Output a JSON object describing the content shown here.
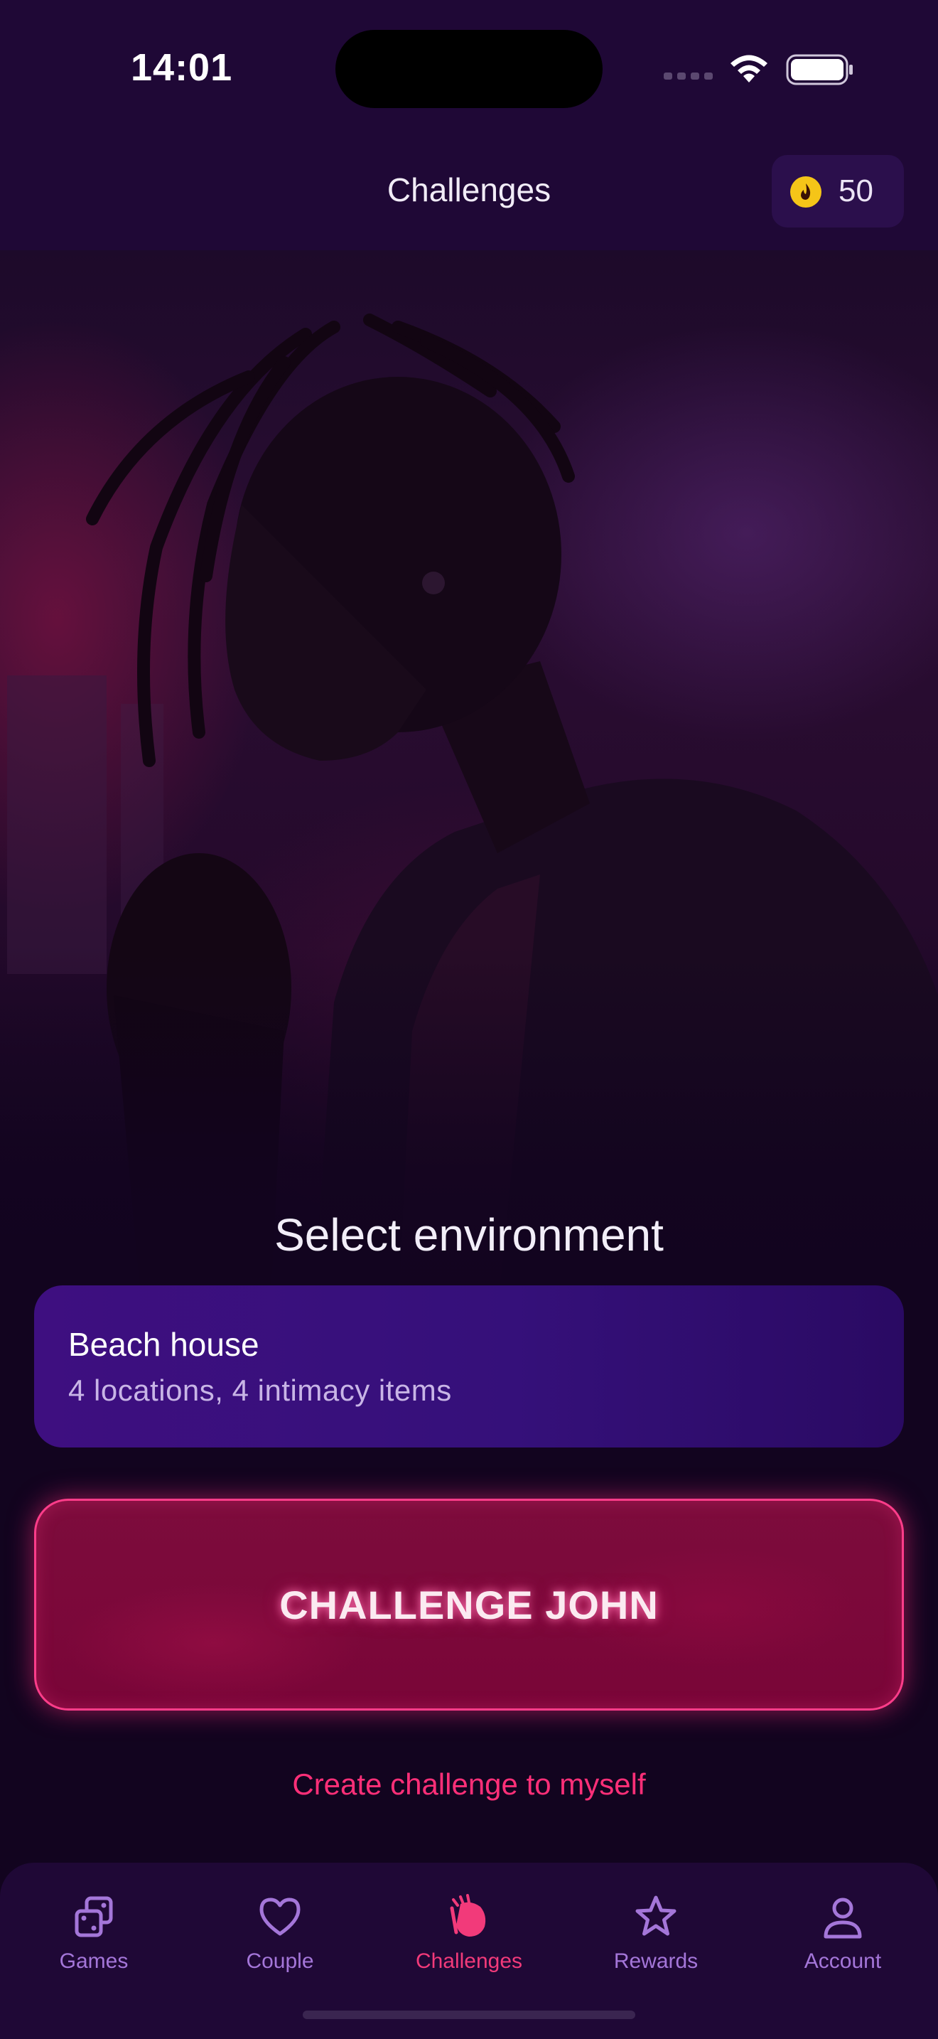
{
  "status_bar": {
    "time": "14:01"
  },
  "header": {
    "title": "Challenges",
    "coin_icon": "flame-coin-icon",
    "coin_balance": "50"
  },
  "environment": {
    "section_title": "Select environment",
    "selected": {
      "name": "Beach house",
      "description": "4 locations, 4 intimacy items"
    }
  },
  "actions": {
    "challenge_label": "CHALLENGE JOHN",
    "self_challenge_label": "Create challenge to myself"
  },
  "tab_bar": {
    "active": "Challenges",
    "tabs": [
      {
        "label": "Games",
        "icon": "dice-icon"
      },
      {
        "label": "Couple",
        "icon": "heart-icon"
      },
      {
        "label": "Challenges",
        "icon": "challenge-cards-icon"
      },
      {
        "label": "Rewards",
        "icon": "star-icon"
      },
      {
        "label": "Account",
        "icon": "person-icon"
      }
    ]
  },
  "colors": {
    "background": "#12041f",
    "bar": "#1f0836",
    "accent_pink": "#ff2f78",
    "tab_inactive": "#a476d9",
    "card_purple": "#3e0f80"
  }
}
